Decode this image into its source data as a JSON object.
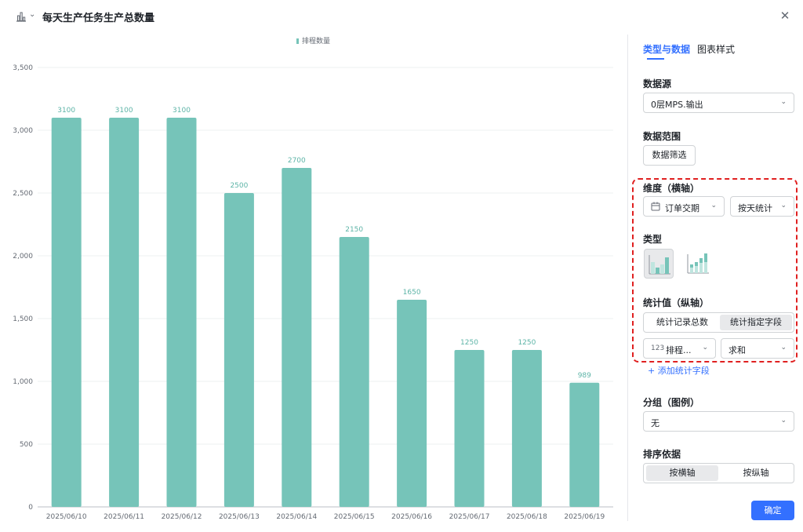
{
  "header": {
    "title": "每天生产任务生产总数量",
    "chart_type_icon": "bar-chart-icon",
    "close_icon": "close-icon",
    "close_glyph": "✕"
  },
  "colors": {
    "bar": "#76c4b9",
    "accent": "#3370ff",
    "alert_outline": "#e02020"
  },
  "chart_data": {
    "type": "bar",
    "categories": [
      "2025/06/10",
      "2025/06/11",
      "2025/06/12",
      "2025/06/13",
      "2025/06/14",
      "2025/06/15",
      "2025/06/16",
      "2025/06/17",
      "2025/06/18",
      "2025/06/19"
    ],
    "series": [
      {
        "name": "排程数量",
        "values": [
          3100,
          3100,
          3100,
          2500,
          2700,
          2150,
          1650,
          1250,
          1250,
          989
        ]
      }
    ],
    "ylim": [
      0,
      3500
    ],
    "yticks": [
      "0",
      "500",
      "1,000",
      "1,500",
      "2,000",
      "2,500",
      "3,000",
      "3,500"
    ],
    "legend_position": "top-center",
    "grid": true
  },
  "panel": {
    "tabs": [
      {
        "label": "类型与数据"
      },
      {
        "label": "图表样式"
      }
    ],
    "data_source": {
      "title": "数据源",
      "value": "0层MPS.输出"
    },
    "data_range": {
      "title": "数据范围",
      "button": "数据筛选"
    },
    "dimension": {
      "title": "维度（横轴）",
      "field": "订单交期",
      "granularity": "按天统计"
    },
    "type": {
      "title": "类型"
    },
    "measure": {
      "title": "统计值（纵轴）",
      "options": [
        "统计记录总数",
        "统计指定字段"
      ],
      "field": "排程...",
      "field_prefix": "123",
      "aggregation": "求和",
      "add_label": "+ 添加统计字段"
    },
    "group": {
      "title": "分组（图例）",
      "value": "无"
    },
    "sort": {
      "title": "排序依据",
      "options": [
        "按横轴",
        "按纵轴"
      ]
    },
    "confirm": "确定"
  }
}
